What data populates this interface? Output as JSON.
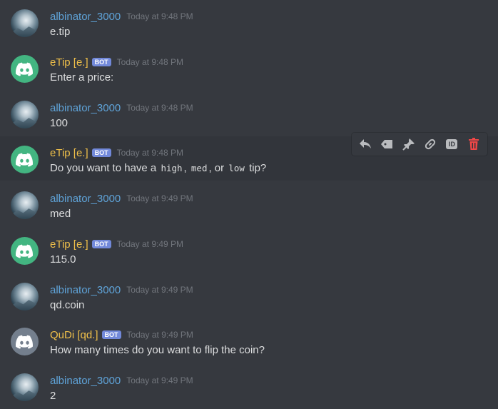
{
  "messages": [
    {
      "author": "albinator_3000",
      "time": "Today at 9:48 PM",
      "text": "e.tip"
    },
    {
      "author": "eTip [e.]",
      "bot": "BOT",
      "time": "Today at 9:48 PM",
      "text": "Enter a price:"
    },
    {
      "author": "albinator_3000",
      "time": "Today at 9:48 PM",
      "text": "100"
    },
    {
      "author": "eTip [e.]",
      "bot": "BOT",
      "time": "Today at 9:48 PM",
      "text_parts": [
        "Do you want to have a",
        "high",
        ",",
        "med",
        ", or",
        "low",
        "tip?"
      ]
    },
    {
      "author": "albinator_3000",
      "time": "Today at 9:49 PM",
      "text": "med"
    },
    {
      "author": "eTip [e.]",
      "bot": "BOT",
      "time": "Today at 9:49 PM",
      "text": "115.0"
    },
    {
      "author": "albinator_3000",
      "time": "Today at 9:49 PM",
      "text": "qd.coin"
    },
    {
      "author": "QuDi [qd.]",
      "bot": "BOT",
      "time": "Today at 9:49 PM",
      "text": "How many times do you want to flip the coin?"
    },
    {
      "author": "albinator_3000",
      "time": "Today at 9:49 PM",
      "text": "2"
    }
  ],
  "toolbar": {
    "id_label": "ID",
    "icons": [
      "reply-icon",
      "tag-icon",
      "pin-icon",
      "link-icon",
      "id-icon",
      "delete-icon"
    ]
  },
  "colors": {
    "background": "#36393f",
    "user_name": "#5fa3d8",
    "bot_name": "#f0c04a",
    "bot_badge": "#7289da",
    "etip_avatar": "#43b581",
    "qudi_avatar": "#747f8d",
    "delete": "#f04747"
  }
}
